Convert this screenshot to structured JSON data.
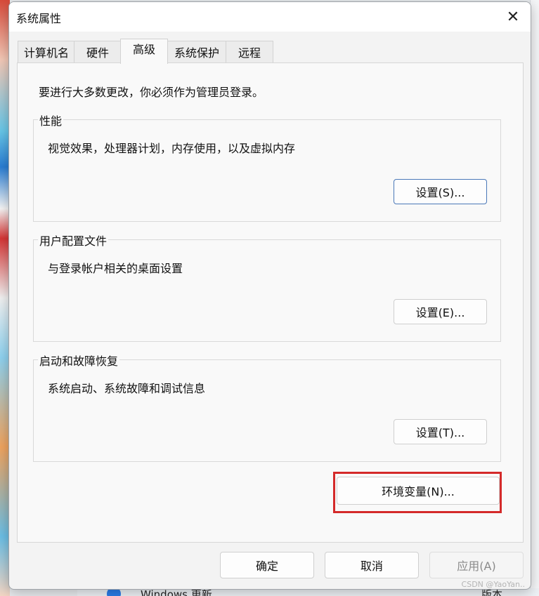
{
  "window": {
    "title": "系统属性"
  },
  "tabs": [
    {
      "label": "计算机名"
    },
    {
      "label": "硬件"
    },
    {
      "label": "高级"
    },
    {
      "label": "系统保护"
    },
    {
      "label": "远程"
    }
  ],
  "admin_note": "要进行大多数更改，你必须作为管理员登录。",
  "groups": {
    "performance": {
      "title": "性能",
      "desc": "视觉效果，处理器计划，内存使用，以及虚拟内存",
      "button": "设置(S)..."
    },
    "profile": {
      "title": "用户配置文件",
      "desc": "与登录帐户相关的桌面设置",
      "button": "设置(E)..."
    },
    "startup": {
      "title": "启动和故障恢复",
      "desc": "系统启动、系统故障和调试信息",
      "button": "设置(T)..."
    }
  },
  "env_button": "环境变量(N)...",
  "footer": {
    "ok": "确定",
    "cancel": "取消",
    "apply": "应用(A)"
  },
  "background": {
    "taskbar_text": "Windows 更新",
    "right_text": "版本"
  },
  "watermark": "CSDN @YaoYan..",
  "colors": {
    "highlight": "#d42a2a",
    "focus_border": "#4a78b8"
  }
}
